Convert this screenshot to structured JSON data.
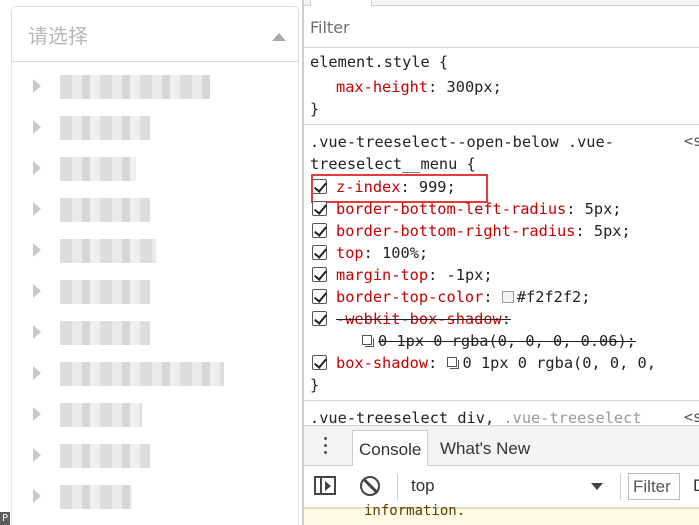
{
  "treeselect": {
    "placeholder": "请选择",
    "option_count": 11
  },
  "bottom_glyph": "P",
  "devtools": {
    "styles_filter": "Filter",
    "element_style": {
      "selector": "element.style {",
      "prop": "max-height",
      "value": "300px;",
      "close": "}"
    },
    "rule": {
      "selector_line1": ".vue-treeselect--open-below .vue-",
      "selector_line2": "treeselect__menu {",
      "source": "<s",
      "props": [
        {
          "name": "z-index",
          "value": "999;"
        },
        {
          "name": "border-bottom-left-radius",
          "value": "5px;"
        },
        {
          "name": "border-bottom-right-radius",
          "value": "5px;"
        },
        {
          "name": "top",
          "value": "100%;"
        },
        {
          "name": "margin-top",
          "value": "-1px;"
        },
        {
          "name": "border-top-color",
          "value": "#f2f2f2;"
        },
        {
          "name": "-webkit-box-shadow",
          "value": ""
        },
        {
          "name": "box-shadow",
          "value": "0 1px 0 rgba(0, 0, 0,"
        }
      ],
      "webkit_shadow_value": "0 1px 0 rgba(0, 0, 0, 0.06);",
      "close": "}"
    },
    "next_rule": {
      "selector_a": ".vue-treeselect div, ",
      "selector_b": ".vue-treeselect",
      "source": "<s"
    },
    "drawer": {
      "tabs": [
        "Console",
        "What's New"
      ],
      "context": "top",
      "filter": "Filter",
      "default_levels": "D",
      "message": "information."
    }
  },
  "colors": {
    "prop_name": "#c80000",
    "highlight_box": "#e53b3b",
    "border_top_swatch": "#f2f2f2"
  }
}
